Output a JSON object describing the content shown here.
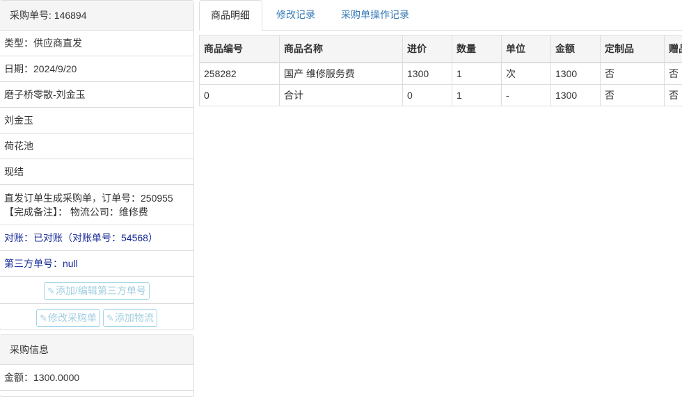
{
  "order_panel": {
    "heading": "采购单号: 146894",
    "type": "类型：供应商直发",
    "date": "日期：2024/9/20",
    "supplier": "磨子桥零散-刘金玉",
    "person": "刘金玉",
    "location": "荷花池",
    "payment": "现结",
    "note_line1": "直发订单生成采购单，订单号：250955",
    "note_line2": "【完成备注】： 物流公司：维修费",
    "reconcile": "对账：已对账（对账单号：54568）",
    "third_party": "第三方单号：null",
    "btn_third_party": "添加/编辑第三方单号",
    "btn_edit_order": "修改采购单",
    "btn_add_logistics": "添加物流"
  },
  "purchase_panel": {
    "heading": "采购信息",
    "amount": "金额：1300.0000"
  },
  "tabs": [
    {
      "label": "商品明细"
    },
    {
      "label": "修改记录"
    },
    {
      "label": "采购单操作记录"
    }
  ],
  "goods_table": {
    "headers": [
      "商品编号",
      "商品名称",
      "进价",
      "数量",
      "单位",
      "金额",
      "定制品",
      "赠品"
    ],
    "rows": [
      [
        "258282",
        "国产 维修服务费",
        "1300",
        "1",
        "次",
        "1300",
        "否",
        "否"
      ],
      [
        "0",
        "合计",
        "0",
        "1",
        "-",
        "1300",
        "否",
        "否"
      ]
    ]
  }
}
